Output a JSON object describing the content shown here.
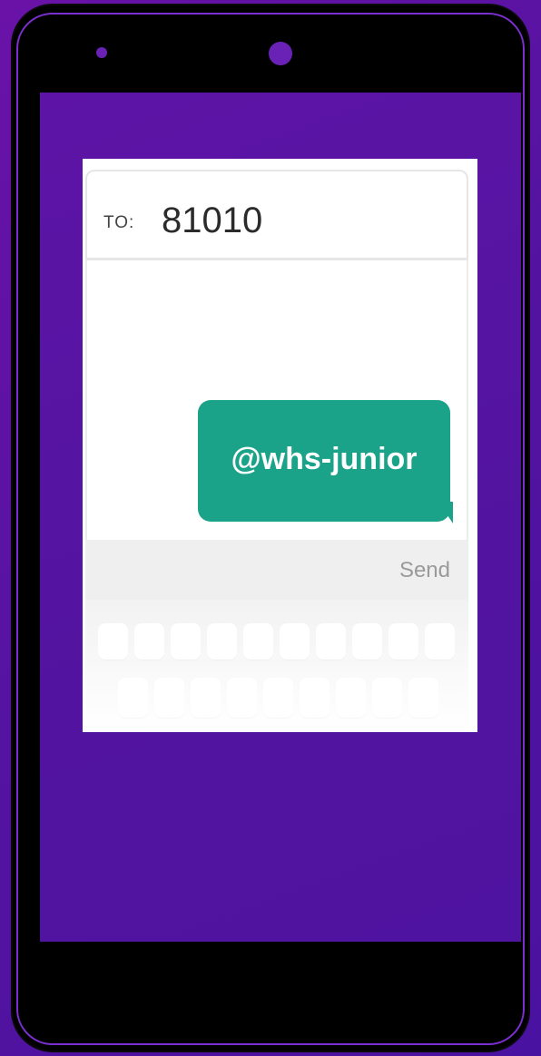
{
  "message": {
    "to_label": "TO:",
    "to_number": "81010",
    "bubble_text": "@whs-junior",
    "send_label": "Send"
  },
  "keyboard": {
    "row1_keys": 10,
    "row2_keys": 9
  },
  "colors": {
    "background": "#5a14a4",
    "bubble": "#1aa388",
    "phone_body": "#000000",
    "phone_trim": "#7b2fd0"
  },
  "icons": [
    "speaker-dot",
    "camera-dot"
  ]
}
